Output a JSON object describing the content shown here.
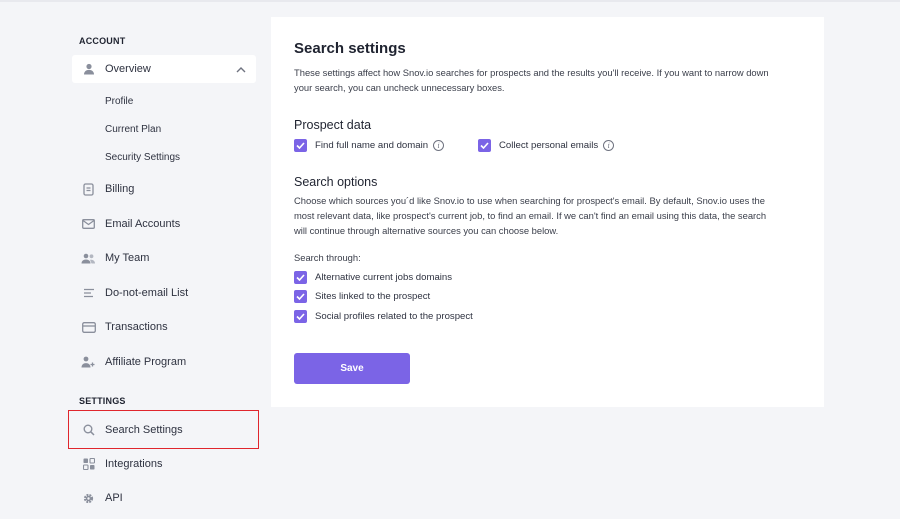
{
  "sidebar": {
    "account_title": "ACCOUNT",
    "settings_title": "SETTINGS",
    "overview_label": "Overview",
    "sub_items": [
      "Profile",
      "Current Plan",
      "Security Settings"
    ],
    "items": [
      {
        "label": "Billing",
        "icon": "document-icon"
      },
      {
        "label": "Email Accounts",
        "icon": "envelope-icon"
      },
      {
        "label": "My Team",
        "icon": "team-icon"
      },
      {
        "label": "Do-not-email List",
        "icon": "list-icon"
      },
      {
        "label": "Transactions",
        "icon": "card-icon"
      },
      {
        "label": "Affiliate Program",
        "icon": "user-plus-icon"
      }
    ],
    "settings_items": [
      {
        "label": "Search Settings",
        "icon": "search-icon"
      },
      {
        "label": "Integrations",
        "icon": "grid-icon"
      },
      {
        "label": "API",
        "icon": "gear-icon"
      }
    ]
  },
  "main": {
    "title": "Search settings",
    "intro_line1": "These settings affect how Snov.io searches for prospects and the results you'll receive. If you want to narrow down",
    "intro_line2": "your search, you can uncheck unnecessary boxes.",
    "prospect_title": "Prospect data",
    "prospect_options": [
      "Find full name and domain",
      "Collect personal emails"
    ],
    "options_title": "Search options",
    "options_line1": "Choose which sources you´d like Snov.io to use when searching for prospect's email. By default, Snov.io uses the",
    "options_line2": "most relevant data, like prospect's current job, to find an email. If we can't find an email using this data, the search",
    "options_line3": "will continue through alternative sources you can choose below.",
    "search_through": "Search through:",
    "through_options": [
      "Alternative current jobs domains",
      "Sites linked to the prospect",
      "Social profiles related to the prospect"
    ],
    "save_label": "Save"
  },
  "colors": {
    "accent": "#7b64e6",
    "highlight": "#e0262d"
  }
}
